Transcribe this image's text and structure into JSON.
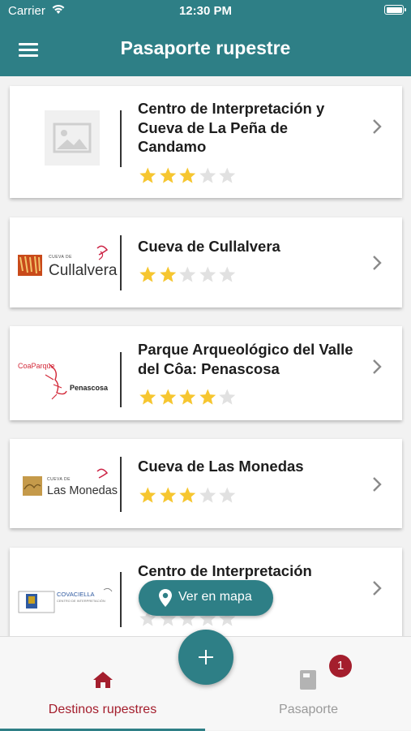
{
  "status_bar": {
    "carrier": "Carrier",
    "time": "12:30 PM"
  },
  "nav": {
    "title": "Pasaporte rupestre",
    "menu_icon": "hamburger-menu-icon"
  },
  "colors": {
    "primary": "#2e7f86",
    "accent": "#a41e2d",
    "star_on": "#f6c630",
    "star_off": "#e1e1e1"
  },
  "destinations": [
    {
      "name": "Centro de Interpretación y Cueva de La Peña de Candamo",
      "logo": "placeholder-image-icon",
      "rating": 3,
      "max_rating": 5
    },
    {
      "name": "Cueva de Cullalvera",
      "logo": "cullalvera-logo",
      "logo_text_small": "CUEVA DE",
      "logo_text": "Cullalvera",
      "rating": 2,
      "max_rating": 5
    },
    {
      "name": "Parque Arqueológico  del Valle del Côa:  Penascosa",
      "logo": "coaparque-logo",
      "logo_text_small": "CoaParque",
      "logo_text": "Penascosa",
      "rating": 4,
      "max_rating": 5
    },
    {
      "name": "Cueva de Las Monedas",
      "logo": "las-monedas-logo",
      "logo_text_small": "CUEVA DE",
      "logo_text": "Las Monedas",
      "rating": 3,
      "max_rating": 5
    },
    {
      "name": "Centro de Interpretación",
      "logo": "covaciella-logo",
      "logo_text": "COVACIELLA",
      "logo_text_small": "CENTRO DE INTERPRETACIÓN",
      "rating": 0,
      "max_rating": 5
    }
  ],
  "map_button": {
    "label": "Ver en mapa",
    "icon": "map-pin-icon"
  },
  "add_button": {
    "icon": "plus-icon"
  },
  "tabs": [
    {
      "label": "Destinos rupestres",
      "icon": "home-icon",
      "active": true
    },
    {
      "label": "Pasaporte",
      "icon": "book-icon",
      "active": false,
      "badge": "1"
    }
  ]
}
